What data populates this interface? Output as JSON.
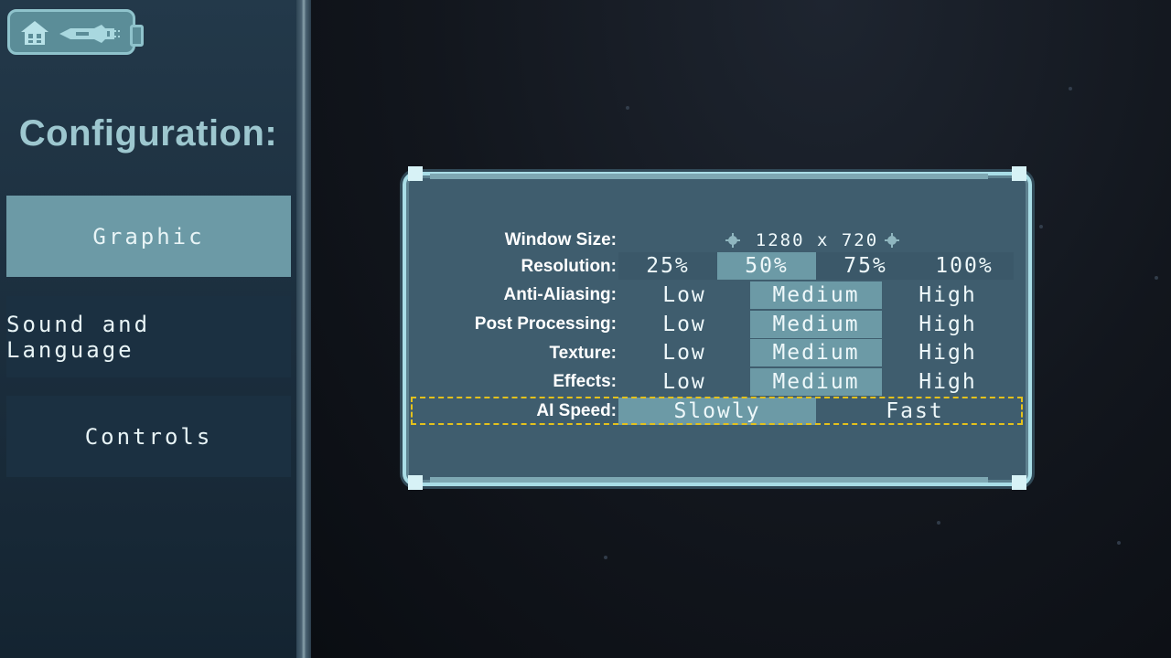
{
  "sidebar": {
    "title": "Configuration:",
    "items": [
      {
        "label": "Graphic",
        "active": true
      },
      {
        "label": "Sound and Language",
        "active": false
      },
      {
        "label": "Controls",
        "active": false
      }
    ]
  },
  "icons": {
    "home": "home-icon",
    "ship": "ship-icon",
    "arrows": "gear-arrow-icon"
  },
  "settings": {
    "window_size": {
      "label": "Window Size:",
      "value": "1280 x 720"
    },
    "resolution": {
      "label": "Resolution:",
      "options": [
        "25%",
        "50%",
        "75%",
        "100%"
      ],
      "selected": "50%"
    },
    "anti_aliasing": {
      "label": "Anti-Aliasing:",
      "options": [
        "Low",
        "Medium",
        "High"
      ],
      "selected": "Medium"
    },
    "post_processing": {
      "label": "Post Processing:",
      "options": [
        "Low",
        "Medium",
        "High"
      ],
      "selected": "Medium"
    },
    "texture": {
      "label": "Texture:",
      "options": [
        "Low",
        "Medium",
        "High"
      ],
      "selected": "Medium"
    },
    "effects": {
      "label": "Effects:",
      "options": [
        "Low",
        "Medium",
        "High"
      ],
      "selected": "Medium"
    },
    "ai_speed": {
      "label": "AI Speed:",
      "options": [
        "Slowly",
        "Fast"
      ],
      "selected": "Slowly"
    }
  },
  "colors": {
    "accent_selected": "#6c9aa6",
    "focus_outline": "#e4c11c",
    "title_text": "#9dc7cf",
    "panel_border": "#a9dde6"
  }
}
